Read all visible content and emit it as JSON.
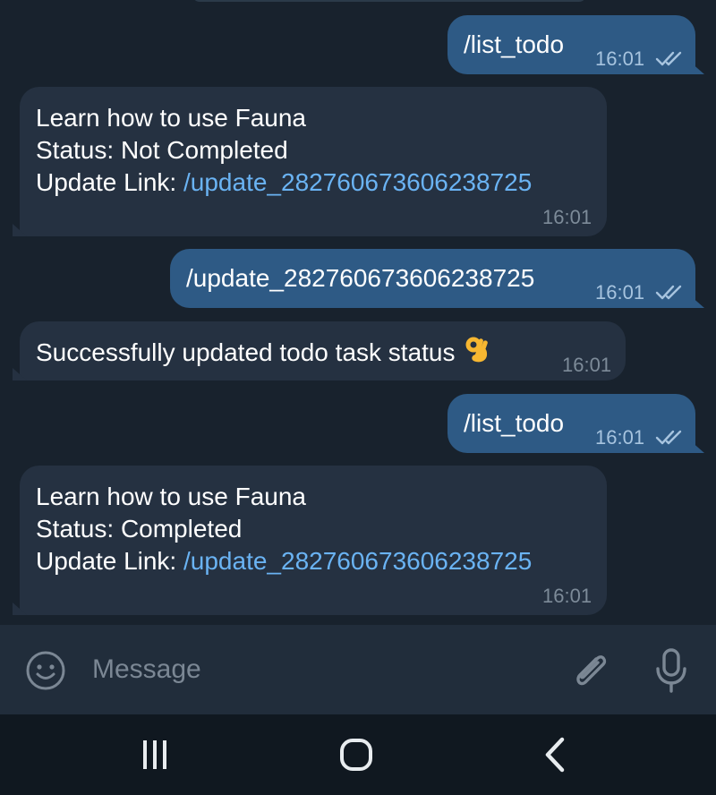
{
  "messages": [
    {
      "direction": "out",
      "text": "/list_todo",
      "time": "16:01",
      "read": true
    },
    {
      "direction": "in",
      "lines": [
        "Learn how to use Fauna",
        "Status: Not Completed"
      ],
      "link_label": "Update Link: ",
      "link": "/update_282760673606238725",
      "time": "16:01"
    },
    {
      "direction": "out",
      "text": "/update_282760673606238725",
      "time": "16:01",
      "read": true
    },
    {
      "direction": "in",
      "text": "Successfully updated todo task status",
      "emoji": "ok-hand",
      "time": "16:01"
    },
    {
      "direction": "out",
      "text": "/list_todo",
      "time": "16:01",
      "read": true
    },
    {
      "direction": "in",
      "lines": [
        "Learn how to use Fauna",
        "Status: Completed"
      ],
      "link_label": "Update Link: ",
      "link": "/update_282760673606238725",
      "time": "16:01"
    }
  ],
  "input": {
    "placeholder": "Message"
  },
  "icons": {
    "emoji": "smile-icon",
    "attach": "paperclip-icon",
    "mic": "microphone-icon",
    "nav": [
      "recent-apps-icon",
      "home-icon",
      "back-icon"
    ]
  },
  "colors": {
    "background": "#18222d",
    "incoming": "#253141",
    "outgoing": "#2e5a85",
    "link": "#6ab3f3"
  }
}
